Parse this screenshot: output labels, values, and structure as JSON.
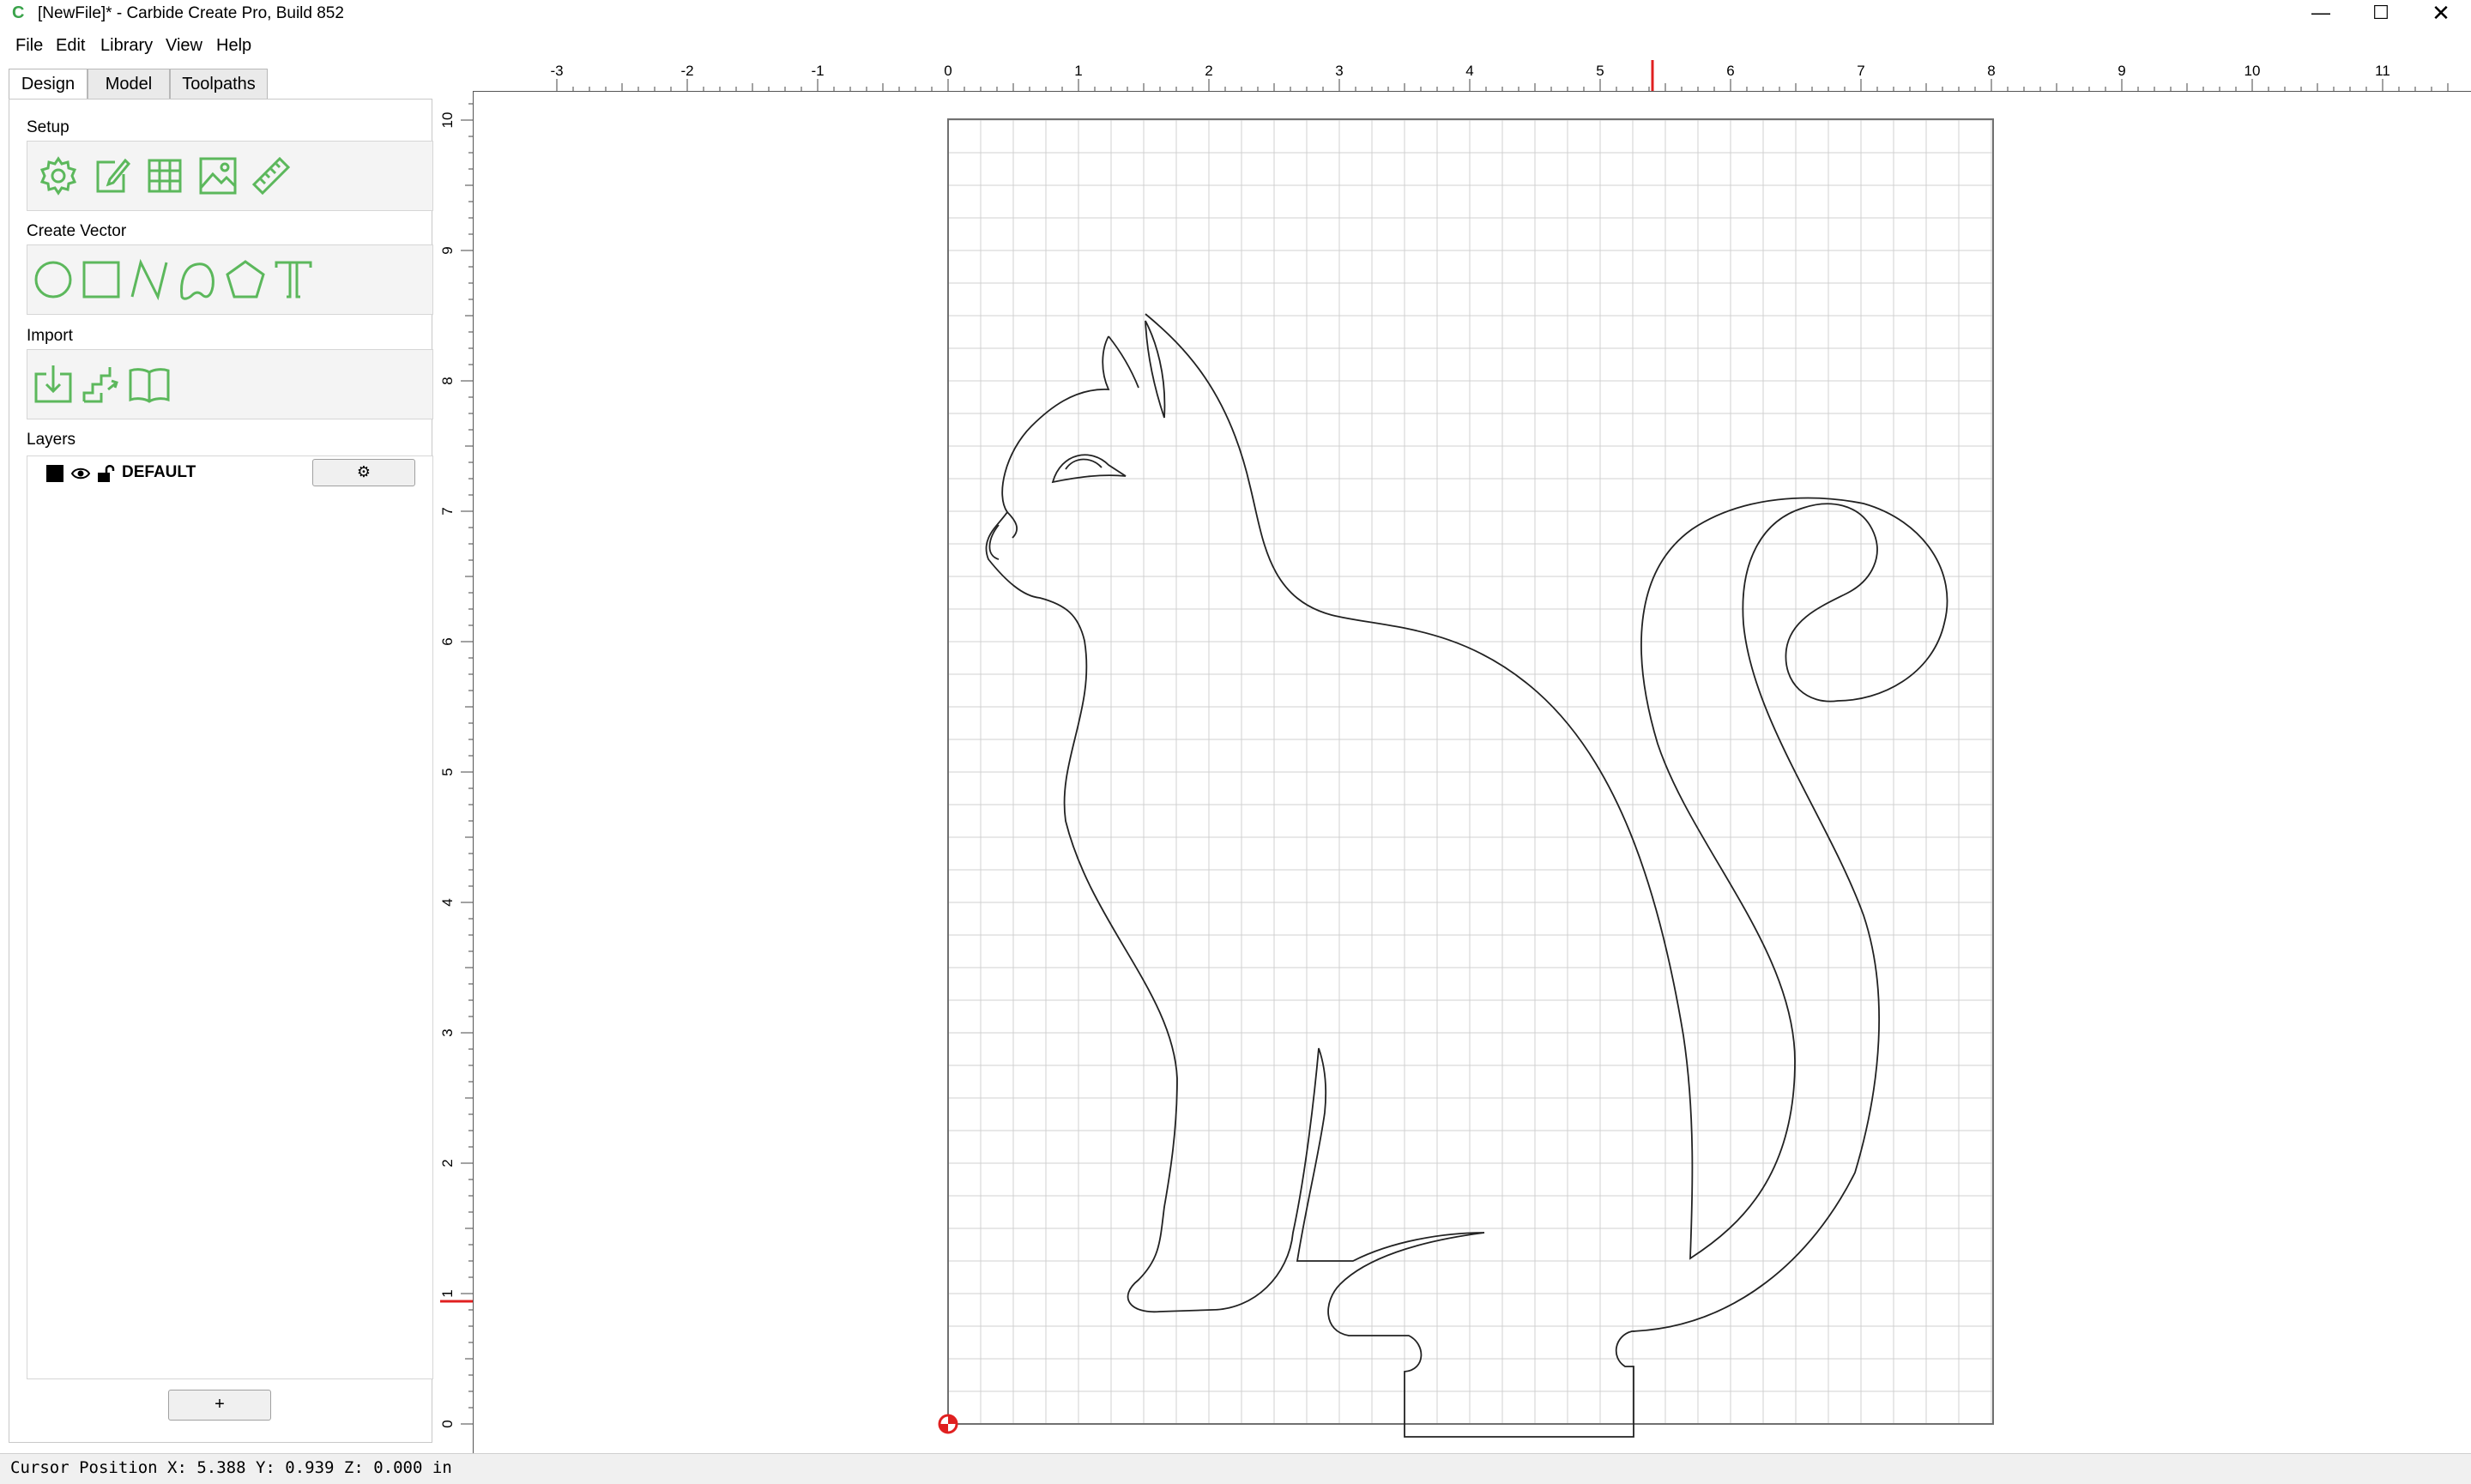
{
  "window": {
    "title": "[NewFile]* - Carbide Create Pro, Build 852",
    "minimize": "—",
    "maximize": "☐",
    "close": "✕"
  },
  "menu": [
    "File",
    "Edit",
    "Library",
    "View",
    "Help"
  ],
  "tabs": [
    {
      "label": "Design",
      "active": true
    },
    {
      "label": "Model",
      "active": false
    },
    {
      "label": "Toolpaths",
      "active": false
    }
  ],
  "sections": {
    "setup": "Setup",
    "create_vector": "Create Vector",
    "import": "Import",
    "layers": "Layers"
  },
  "setup_tools": [
    "job-setup-gear-icon",
    "edit-note-icon",
    "grid-icon",
    "image-icon",
    "ruler-icon"
  ],
  "vector_tools": [
    "circle-icon",
    "rectangle-icon",
    "polyline-icon",
    "curve-icon",
    "polygon-icon",
    "text-icon"
  ],
  "import_tools": [
    "import-svg-icon",
    "import-stairs-icon",
    "library-book-icon"
  ],
  "layers": [
    {
      "name": "DEFAULT",
      "color": "#000000",
      "settings_icon": "⚙"
    }
  ],
  "add_layer_label": "+",
  "ruler": {
    "x_labels": [
      "-3",
      "-2",
      "-1",
      "0",
      "1",
      "2",
      "3",
      "4",
      "5",
      "6",
      "7",
      "8",
      "9",
      "10",
      "11"
    ],
    "y_labels": [
      "10",
      "9",
      "8",
      "7",
      "6",
      "5",
      "4",
      "3",
      "2",
      "1",
      "0"
    ],
    "marker_color": "#e02020"
  },
  "accent_color": "#5cb85c",
  "status": {
    "text": "Cursor Position X: 5.388 Y: 0.939 Z: 0.000 in"
  }
}
